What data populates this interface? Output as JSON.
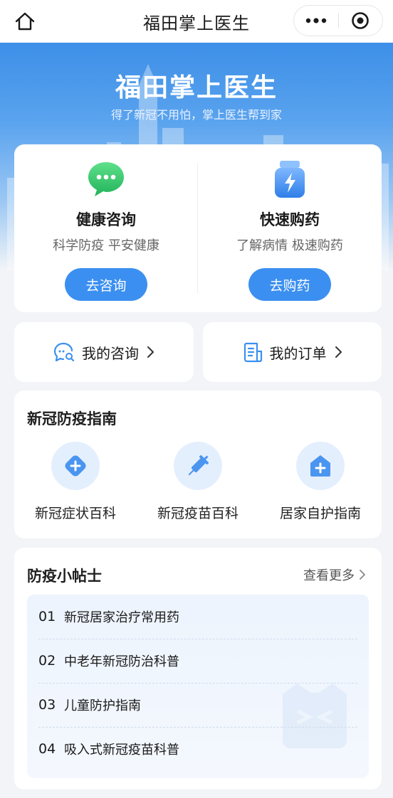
{
  "navbar": {
    "title": "福田掌上医生",
    "home_icon": "home-icon",
    "more_icon": "more-dots-icon",
    "close_icon": "target-circle-icon"
  },
  "hero": {
    "title": "福田掌上医生",
    "subtitle": "得了新冠不用怕，掌上医生帮到家"
  },
  "features": [
    {
      "icon": "chat-bubble-icon",
      "title": "健康咨询",
      "desc": "科学防疫 平安健康",
      "button": "去咨询"
    },
    {
      "icon": "medicine-bottle-icon",
      "title": "快速购药",
      "desc": "了解病情 极速购药",
      "button": "去购药"
    }
  ],
  "quick_links": [
    {
      "icon": "consult-search-icon",
      "label": "我的咨询"
    },
    {
      "icon": "order-list-icon",
      "label": "我的订单"
    }
  ],
  "guide": {
    "title": "新冠防疫指南",
    "items": [
      {
        "icon": "plus-diamond-icon",
        "label": "新冠症状百科"
      },
      {
        "icon": "syringe-icon",
        "label": "新冠疫苗百科"
      },
      {
        "icon": "home-medical-icon",
        "label": "居家自护指南"
      }
    ]
  },
  "tips": {
    "title": "防疫小帖士",
    "more": "查看更多",
    "items": [
      {
        "num": "01",
        "text": "新冠居家治疗常用药"
      },
      {
        "num": "02",
        "text": "中老年新冠防治科普"
      },
      {
        "num": "03",
        "text": "儿童防护指南"
      },
      {
        "num": "04",
        "text": "吸入式新冠疫苗科普"
      }
    ]
  },
  "colors": {
    "accent": "#3b8ff0",
    "hero_top": "#3d8fe8",
    "background": "#f2f4f7"
  }
}
